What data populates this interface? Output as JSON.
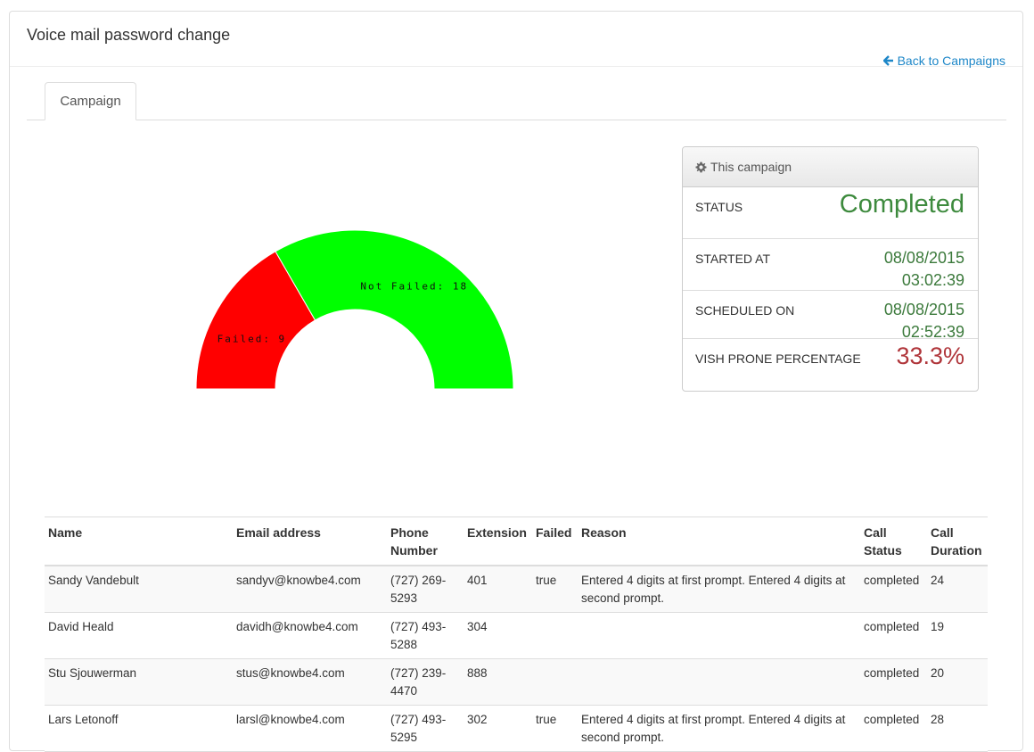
{
  "header": {
    "title": "Voice mail password change",
    "back_label": "Back to Campaigns"
  },
  "tabs": [
    {
      "label": "Campaign"
    }
  ],
  "chart_data": {
    "type": "pie",
    "style": "half-donut",
    "slices": [
      {
        "label": "Failed: 9",
        "name": "Failed",
        "value": 9,
        "color": "#ff0000"
      },
      {
        "label": "Not Failed: 18",
        "name": "Not Failed",
        "value": 18,
        "color": "#00ff00"
      }
    ]
  },
  "campaign_box": {
    "title": "This campaign",
    "rows": [
      {
        "label": "STATUS",
        "value": "Completed"
      },
      {
        "label": "STARTED AT",
        "value": "08/08/2015 03:02:39"
      },
      {
        "label": "SCHEDULED ON",
        "value": "08/08/2015 02:52:39"
      },
      {
        "label": "VISH PRONE PERCENTAGE",
        "value": "33.3%"
      }
    ]
  },
  "table": {
    "headers": [
      "Name",
      "Email address",
      "Phone Number",
      "Extension",
      "Failed",
      "Reason",
      "Call Status",
      "Call Duration"
    ],
    "rows": [
      [
        "Sandy Vandebult",
        "sandyv@knowbe4.com",
        "(727) 269-5293",
        "401",
        "true",
        "Entered 4 digits at first prompt. Entered 4 digits at second prompt.",
        "completed",
        "24"
      ],
      [
        "David Heald",
        "davidh@knowbe4.com",
        "(727) 493-5288",
        "304",
        "",
        "",
        "completed",
        "19"
      ],
      [
        "Stu Sjouwerman",
        "stus@knowbe4.com",
        "(727) 239-4470",
        "888",
        "",
        "",
        "completed",
        "20"
      ],
      [
        "Lars Letonoff",
        "larsl@knowbe4.com",
        "(727) 493-5295",
        "302",
        "true",
        "Entered 4 digits at first prompt. Entered 4 digits at second prompt.",
        "completed",
        "28"
      ]
    ]
  },
  "colors": {
    "link": "#1e87c8",
    "status_green": "#3d8a3d",
    "percentage_red": "#b0363b",
    "failed_red": "#ff0000",
    "not_failed_green": "#00ff00"
  },
  "icons": {
    "back": "arrow-left-icon",
    "campaign_box": "gear-icon"
  }
}
